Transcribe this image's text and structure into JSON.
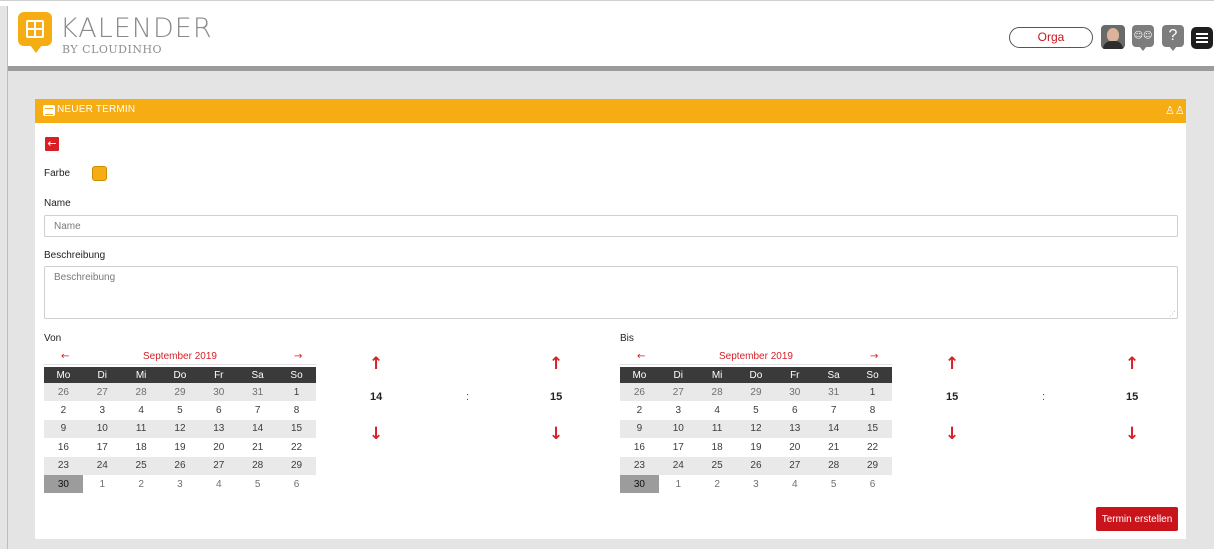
{
  "app": {
    "title": "KALENDER",
    "subtitle": "BY CLOUDINHO",
    "logo_icon": "calendar-logo-icon"
  },
  "header": {
    "orga_label": "Orga",
    "help_label": "?",
    "icons": [
      "avatar",
      "people-icon",
      "help-icon",
      "menu-icon"
    ]
  },
  "panel": {
    "title": "NEUER TERMIN",
    "back_icon": "←",
    "people_icon": "♙♙"
  },
  "form": {
    "color_label": "Farbe",
    "color_value": "#f5ad13",
    "name_label": "Name",
    "name_placeholder": "Name",
    "name_value": "",
    "desc_label": "Beschreibung",
    "desc_placeholder": "Beschreibung",
    "desc_value": "",
    "submit_label": "Termin erstellen"
  },
  "von": {
    "label": "Von",
    "month": "September 2019",
    "prev": "←",
    "next": "→",
    "weekdays": [
      "Mo",
      "Di",
      "Mi",
      "Do",
      "Fr",
      "Sa",
      "So"
    ],
    "weeks": [
      [
        "26",
        "27",
        "28",
        "29",
        "30",
        "31",
        "1"
      ],
      [
        "2",
        "3",
        "4",
        "5",
        "6",
        "7",
        "8"
      ],
      [
        "9",
        "10",
        "11",
        "12",
        "13",
        "14",
        "15"
      ],
      [
        "16",
        "17",
        "18",
        "19",
        "20",
        "21",
        "22"
      ],
      [
        "23",
        "24",
        "25",
        "26",
        "27",
        "28",
        "29"
      ],
      [
        "30",
        "1",
        "2",
        "3",
        "4",
        "5",
        "6"
      ]
    ],
    "selected_day": "30",
    "hour": "14",
    "minute": "15",
    "colon": ":",
    "up": "↑",
    "down": "↓"
  },
  "bis": {
    "label": "Bis",
    "month": "September 2019",
    "prev": "←",
    "next": "→",
    "weekdays": [
      "Mo",
      "Di",
      "Mi",
      "Do",
      "Fr",
      "Sa",
      "So"
    ],
    "weeks": [
      [
        "26",
        "27",
        "28",
        "29",
        "30",
        "31",
        "1"
      ],
      [
        "2",
        "3",
        "4",
        "5",
        "6",
        "7",
        "8"
      ],
      [
        "9",
        "10",
        "11",
        "12",
        "13",
        "14",
        "15"
      ],
      [
        "16",
        "17",
        "18",
        "19",
        "20",
        "21",
        "22"
      ],
      [
        "23",
        "24",
        "25",
        "26",
        "27",
        "28",
        "29"
      ],
      [
        "30",
        "1",
        "2",
        "3",
        "4",
        "5",
        "6"
      ]
    ],
    "selected_day": "30",
    "hour": "15",
    "minute": "15",
    "colon": ":",
    "up": "↑",
    "down": "↓"
  },
  "colors": {
    "accent": "#f5ad13",
    "primary_red": "#c9141c",
    "header_dark": "#3a3a3a"
  }
}
